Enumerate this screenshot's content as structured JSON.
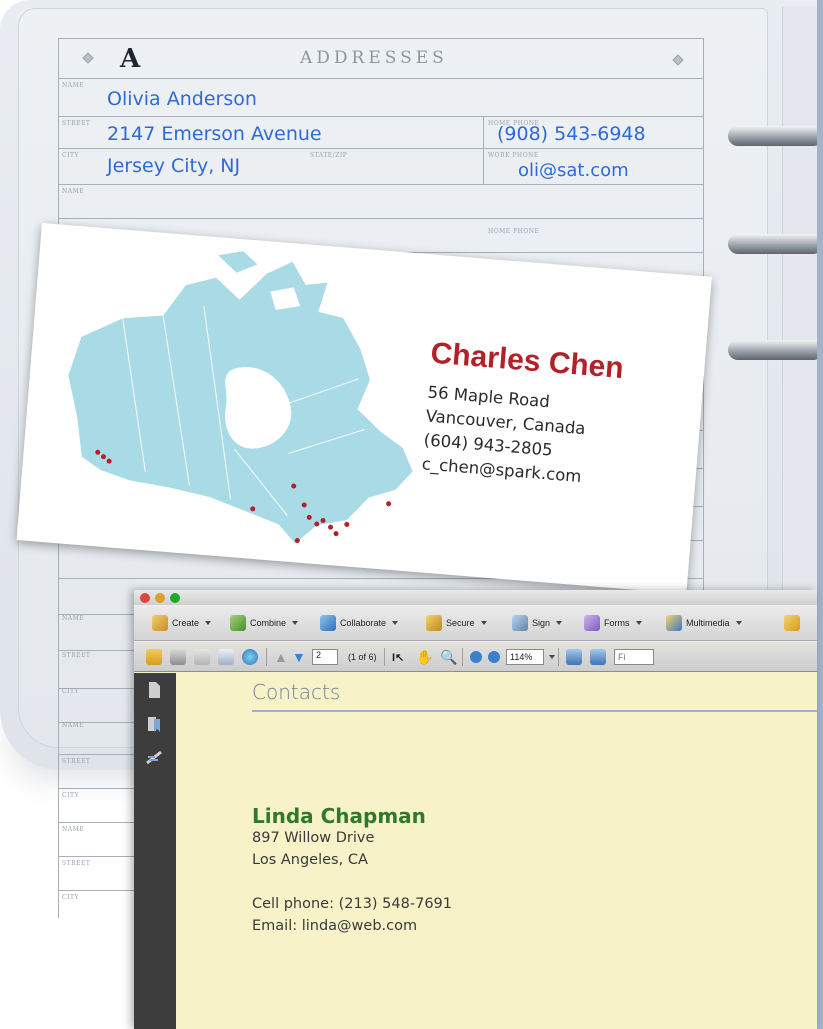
{
  "address_book": {
    "letter": "A",
    "heading": "ADDRESSES",
    "field_labels": {
      "name": "NAME",
      "street": "STREET",
      "city": "CITY",
      "state_zip": "STATE/ZIP",
      "home_phone": "HOME PHONE",
      "work_phone": "WORK PHONE"
    },
    "entry": {
      "name": "Olivia Anderson",
      "street": "2147 Emerson Avenue",
      "city": "Jersey City, NJ",
      "phone": "(908) 543-6948",
      "email": "oli@sat.com"
    }
  },
  "business_card": {
    "name": "Charles Chen",
    "street": "56 Maple Road",
    "city": "Vancouver, Canada",
    "phone": "(604) 943-2805",
    "email": "c_chen@spark.com"
  },
  "app_window": {
    "toolbar_tasks": [
      "Create",
      "Combine",
      "Collaborate",
      "Secure",
      "Sign",
      "Forms",
      "Multimedia"
    ],
    "page_number": "2",
    "page_count": "(1 of 6)",
    "zoom": "114%",
    "find_placeholder": "Fi",
    "colors": {
      "document_background": "#f8f2c9",
      "heading_color": "#6d7f93",
      "contact_name_color": "#2f7a2a"
    }
  },
  "document": {
    "title": "Contacts",
    "contact": {
      "name": "Linda Chapman",
      "street": "897 Willow Drive",
      "city": "Los Angeles, CA",
      "cell_phone": "Cell phone: (213) 548-7691",
      "email": "Email: linda@web.com"
    }
  }
}
